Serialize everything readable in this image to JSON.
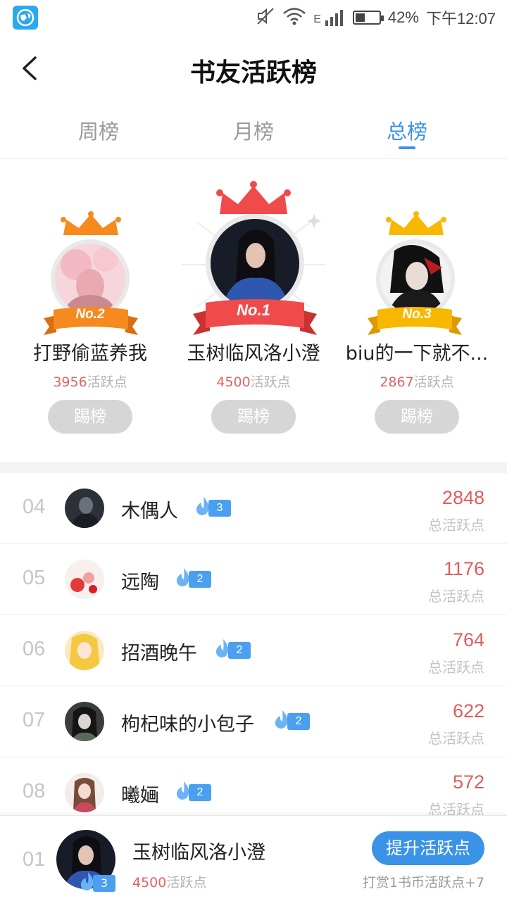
{
  "status_bar": {
    "battery_percent_text": "42%",
    "battery_level": 0.42,
    "time": "下午12:07",
    "network_label": "E"
  },
  "header": {
    "title": "书友活跃榜",
    "back_icon": "chevron-left-icon"
  },
  "tabs": [
    {
      "label": "周榜",
      "active": false
    },
    {
      "label": "月榜",
      "active": false
    },
    {
      "label": "总榜",
      "active": true
    }
  ],
  "podium": {
    "second": {
      "badge": "No.2",
      "name": "打野偷蓝养我",
      "points": "3956",
      "points_unit": "活跃点",
      "button": "踢榜",
      "crown_color": "#f68a1f"
    },
    "first": {
      "badge": "No.1",
      "name": "玉树临风洛小澄",
      "points": "4500",
      "points_unit": "活跃点",
      "button": "踢榜",
      "crown_color": "#ef4b4b"
    },
    "third": {
      "badge": "No.3",
      "name": "biu的一下就不...",
      "points": "2867",
      "points_unit": "活跃点",
      "button": "踢榜",
      "crown_color": "#f8b800"
    }
  },
  "ranking_list": [
    {
      "rank": "04",
      "name": "木偶人",
      "level": "3",
      "score": "2848",
      "score_label": "总活跃点"
    },
    {
      "rank": "05",
      "name": "远陶",
      "level": "2",
      "score": "1176",
      "score_label": "总活跃点"
    },
    {
      "rank": "06",
      "name": "招酒晚午",
      "level": "2",
      "score": "764",
      "score_label": "总活跃点"
    },
    {
      "rank": "07",
      "name": "枸杞味的小包子",
      "level": "2",
      "score": "622",
      "score_label": "总活跃点"
    },
    {
      "rank": "08",
      "name": "曦婳",
      "level": "2",
      "score": "572",
      "score_label": "总活跃点"
    }
  ],
  "my_entry": {
    "rank": "01",
    "name": "玉树临风洛小澄",
    "level": "3",
    "points": "4500",
    "points_unit": "活跃点",
    "boost_button": "提升活跃点",
    "hint": "打赏1书币活跃点+7"
  },
  "colors": {
    "accent_blue": "#3b93e8",
    "score_red": "#e05b5b",
    "kick_button_gray": "#d6d6d6"
  }
}
